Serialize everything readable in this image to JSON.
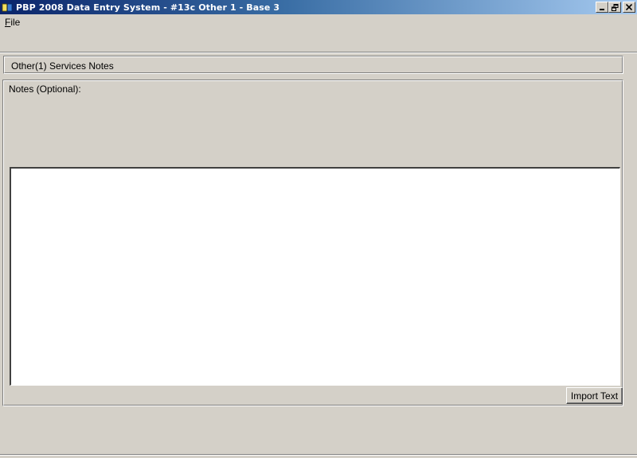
{
  "window": {
    "title": "PBP 2008 Data Entry System - #13c Other 1 - Base 3",
    "icon": "app-book-icon"
  },
  "menu": {
    "file_label": "File",
    "file_accel": "F",
    "file_rest": "ile"
  },
  "section": {
    "title": "Other(1) Services Notes"
  },
  "notes": {
    "label": "Notes (Optional):",
    "value": "",
    "import_button_label": "Import Text"
  },
  "colors": {
    "face": "#d4d0c8",
    "title_start": "#0a246a",
    "title_end": "#a6caf0"
  }
}
